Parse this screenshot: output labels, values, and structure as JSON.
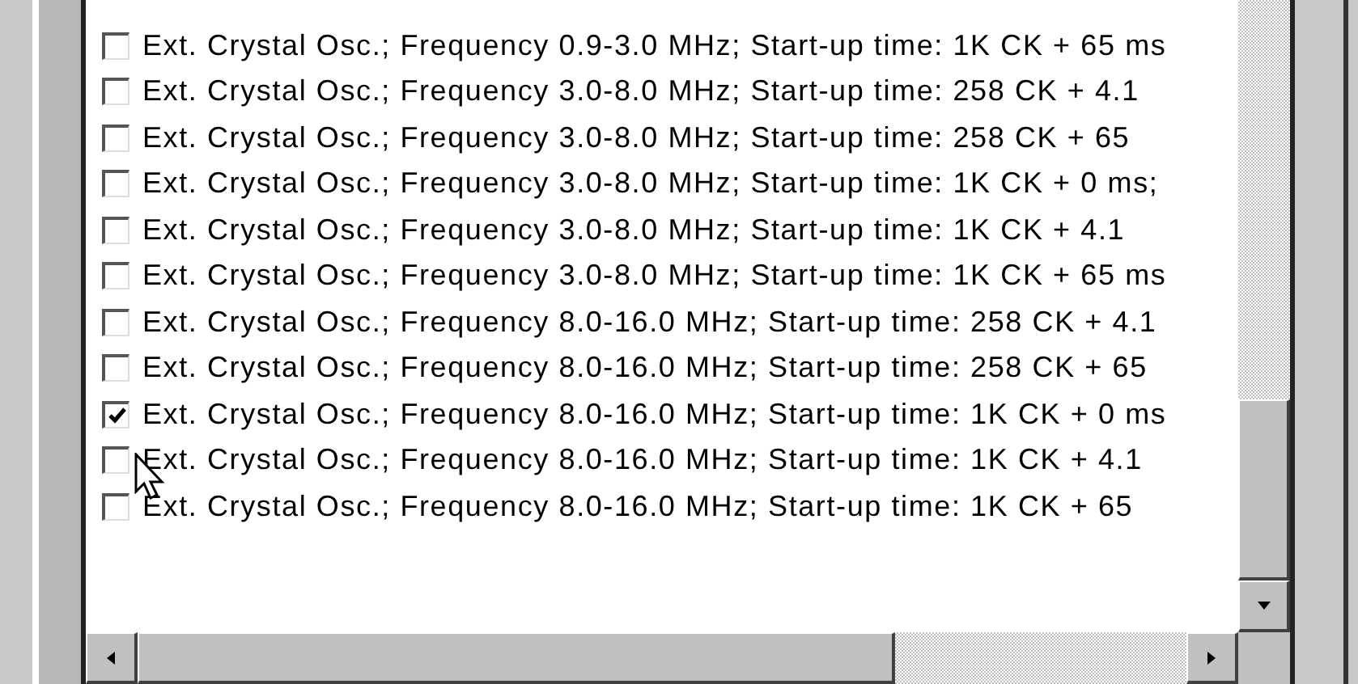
{
  "options": [
    {
      "label": "Ext. Crystal Osc.; Frequency 0.9-3.0 MHz; Start-up time: 1K CK + 65 ms",
      "checked": false
    },
    {
      "label": "Ext. Crystal Osc.; Frequency 3.0-8.0 MHz; Start-up time: 258 CK + 4.1",
      "checked": false
    },
    {
      "label": "Ext. Crystal Osc.; Frequency 3.0-8.0 MHz; Start-up time: 258 CK + 65",
      "checked": false
    },
    {
      "label": "Ext. Crystal Osc.; Frequency 3.0-8.0 MHz; Start-up time: 1K CK + 0 ms;",
      "checked": false
    },
    {
      "label": "Ext. Crystal Osc.; Frequency 3.0-8.0 MHz; Start-up time: 1K CK + 4.1",
      "checked": false
    },
    {
      "label": "Ext. Crystal Osc.; Frequency 3.0-8.0 MHz; Start-up time: 1K CK + 65 ms",
      "checked": false
    },
    {
      "label": "Ext. Crystal Osc.; Frequency 8.0-16.0 MHz; Start-up time: 258 CK + 4.1",
      "checked": false
    },
    {
      "label": "Ext. Crystal Osc.; Frequency 8.0-16.0 MHz; Start-up time: 258 CK + 65",
      "checked": false
    },
    {
      "label": "Ext. Crystal Osc.; Frequency 8.0-16.0 MHz; Start-up time: 1K CK + 0 ms",
      "checked": true
    },
    {
      "label": "Ext. Crystal Osc.; Frequency 8.0-16.0 MHz; Start-up time: 1K CK + 4.1",
      "checked": false
    },
    {
      "label": "Ext. Crystal Osc.; Frequency 8.0-16.0 MHz; Start-up time: 1K CK + 65",
      "checked": false
    }
  ]
}
